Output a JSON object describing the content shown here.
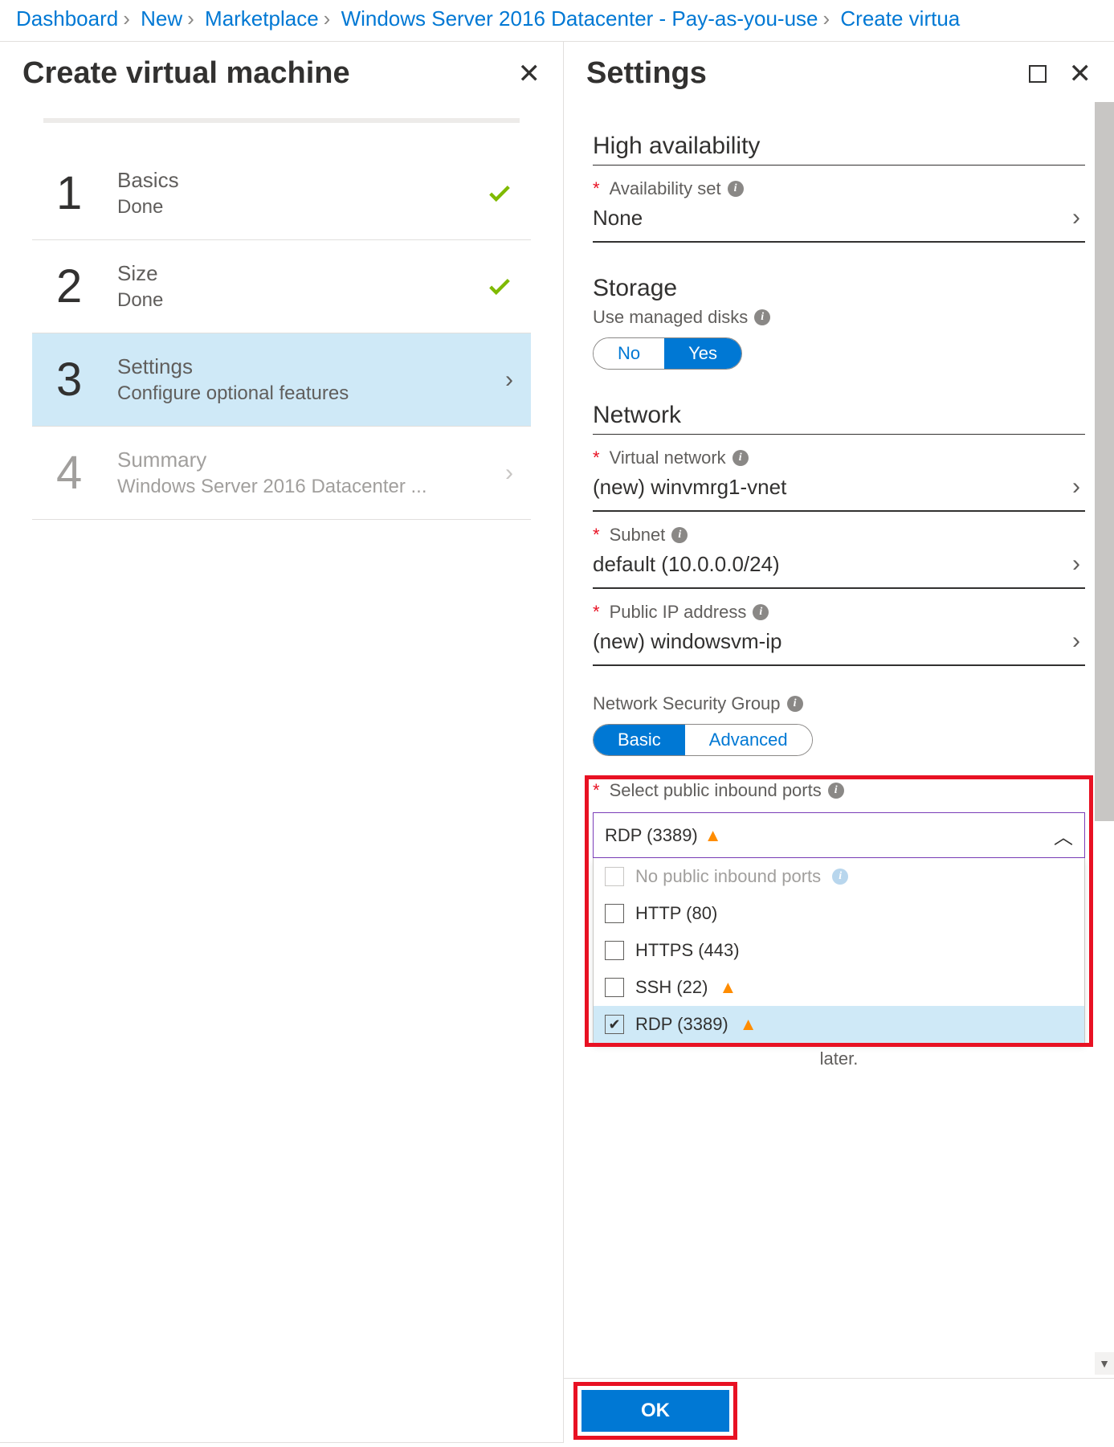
{
  "breadcrumb": [
    "Dashboard",
    "New",
    "Marketplace",
    "Windows Server 2016 Datacenter - Pay-as-you-use",
    "Create virtua"
  ],
  "left": {
    "title": "Create virtual machine",
    "steps": [
      {
        "num": "1",
        "title": "Basics",
        "sub": "Done",
        "status": "done"
      },
      {
        "num": "2",
        "title": "Size",
        "sub": "Done",
        "status": "done"
      },
      {
        "num": "3",
        "title": "Settings",
        "sub": "Configure optional features",
        "status": "active"
      },
      {
        "num": "4",
        "title": "Summary",
        "sub": "Windows Server 2016 Datacenter ...",
        "status": "disabled"
      }
    ]
  },
  "right": {
    "title": "Settings",
    "high_avail": {
      "section": "High availability",
      "avail_label": "Availability set",
      "avail_value": "None"
    },
    "storage": {
      "section": "Storage",
      "managed_label": "Use managed disks",
      "no": "No",
      "yes": "Yes"
    },
    "network": {
      "section": "Network",
      "vnet_label": "Virtual network",
      "vnet_value": "(new) winvmrg1-vnet",
      "subnet_label": "Subnet",
      "subnet_value": "default (10.0.0.0/24)",
      "pip_label": "Public IP address",
      "pip_value": "(new) windowsvm-ip",
      "nsg_label": "Network Security Group",
      "nsg_basic": "Basic",
      "nsg_adv": "Advanced",
      "ports_label": "Select public inbound ports",
      "ports_selected": "RDP (3389)",
      "ports_options": [
        {
          "label": "No public inbound ports",
          "disabled": true,
          "info": true
        },
        {
          "label": "HTTP (80)"
        },
        {
          "label": "HTTPS (443)"
        },
        {
          "label": "SSH (22)",
          "warn": true
        },
        {
          "label": "RDP (3389)",
          "warn": true,
          "checked": true,
          "hover": true
        }
      ],
      "later": "later."
    },
    "ok": "OK"
  }
}
